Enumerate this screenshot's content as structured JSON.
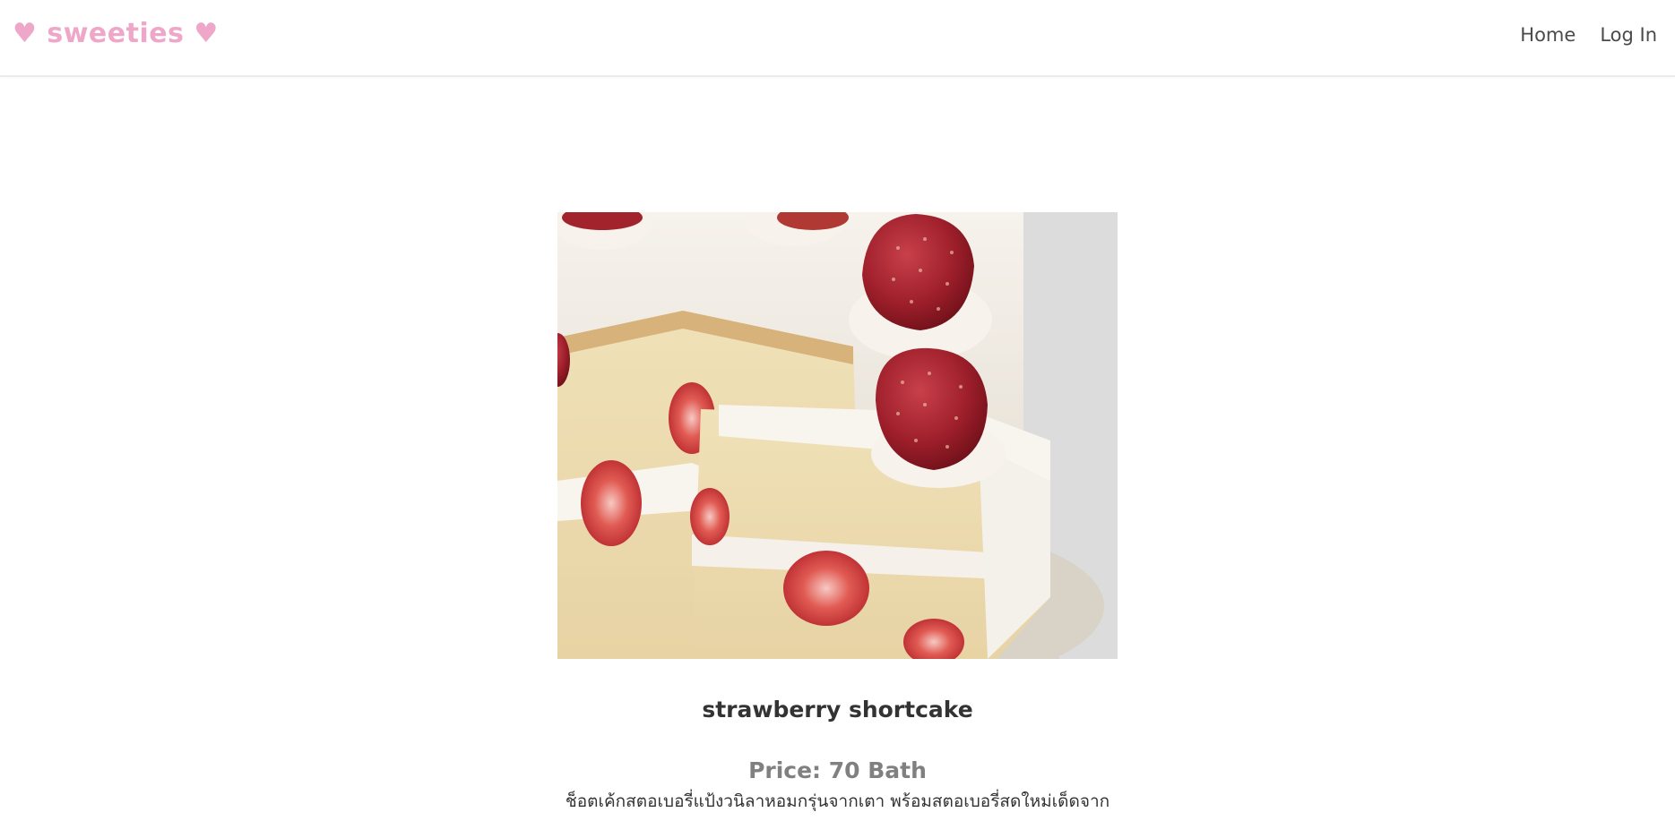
{
  "navbar": {
    "brand": "♥ sweeties ♥",
    "links": [
      {
        "label": "Home"
      },
      {
        "label": "Log In"
      }
    ]
  },
  "product": {
    "name": "strawberry shortcake",
    "price": "Price: 70 Bath",
    "description": "ช็อตเค้กสตอเบอรี่แป้งวนิลาหอมกรุ่นจากเตา พร้อมสตอเบอรี่สดใหม่เด็ดจาก"
  },
  "colors": {
    "brand": "#efa7c9",
    "text": "#333333",
    "price": "#808080"
  }
}
